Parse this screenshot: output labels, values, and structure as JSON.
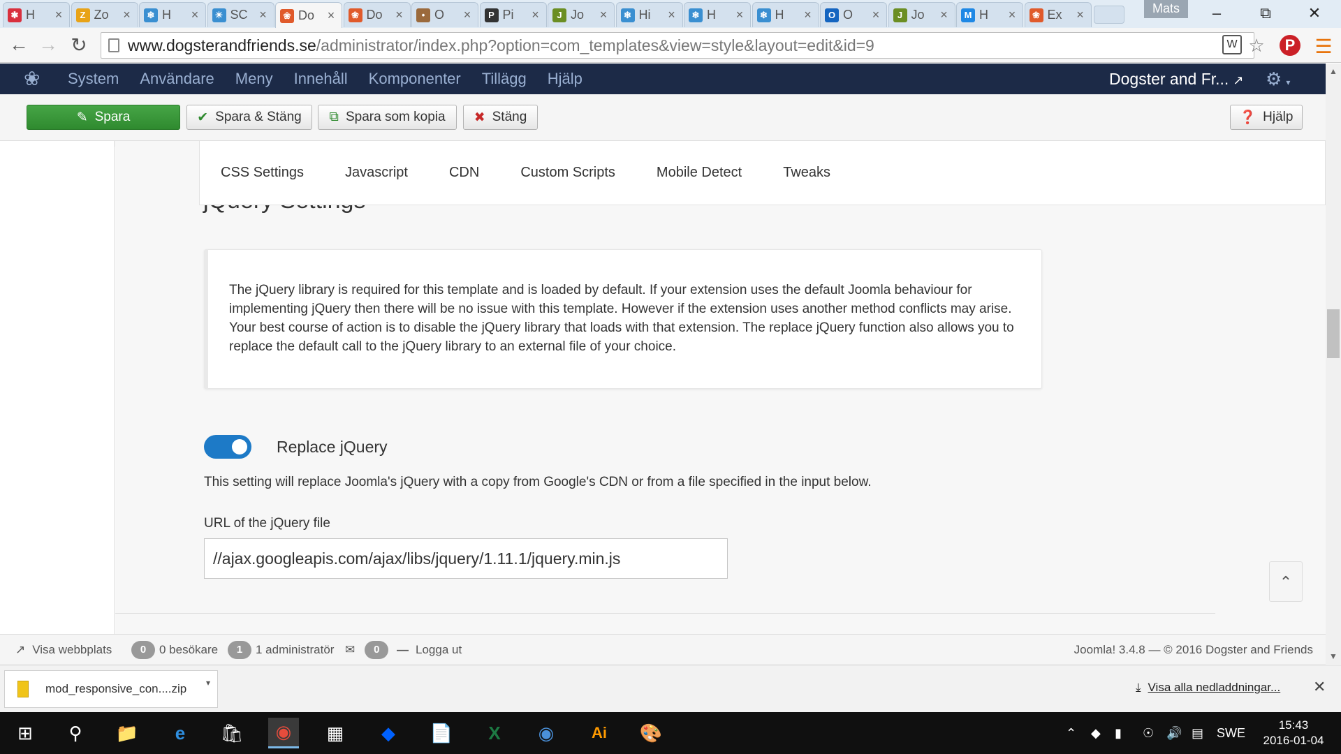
{
  "browser": {
    "tabs": [
      {
        "title": "H",
        "icon": "joomla-red-icon",
        "color": "#d9303e"
      },
      {
        "title": "Zo",
        "icon": "zoho-icon",
        "color": "#e8a317"
      },
      {
        "title": "H",
        "icon": "snowflake-icon",
        "color": "#3a8fd1"
      },
      {
        "title": "SC",
        "icon": "sun-icon",
        "color": "#3a8fd1"
      },
      {
        "title": "Do",
        "icon": "joomla-icon",
        "color": "#e05a2b",
        "active": true
      },
      {
        "title": "Do",
        "icon": "joomla-icon",
        "color": "#e05a2b"
      },
      {
        "title": "O",
        "icon": "dog-icon",
        "color": "#9b6a3c"
      },
      {
        "title": "Pi",
        "icon": "pinterest-icon",
        "color": "#333333"
      },
      {
        "title": "Jo",
        "icon": "joomla-j-icon",
        "color": "#6b8e23"
      },
      {
        "title": "Hi",
        "icon": "snowflake-icon",
        "color": "#3a8fd1"
      },
      {
        "title": "H",
        "icon": "snowflake-icon",
        "color": "#3a8fd1"
      },
      {
        "title": "H",
        "icon": "snowflake-icon",
        "color": "#3a8fd1"
      },
      {
        "title": "O",
        "icon": "outlook-icon",
        "color": "#1565c0"
      },
      {
        "title": "Jo",
        "icon": "joomla-j-icon",
        "color": "#6b8e23"
      },
      {
        "title": "H",
        "icon": "mj-icon",
        "color": "#1e88e5"
      },
      {
        "title": "Ex",
        "icon": "joomla-icon",
        "color": "#e05a2b"
      }
    ],
    "profile_name": "Mats",
    "url_host": "www.dogsterandfriends.se",
    "url_path": "/administrator/index.php?option=com_templates&view=style&layout=edit&id=9"
  },
  "joomla_nav": {
    "menu": [
      "System",
      "Användare",
      "Meny",
      "Innehåll",
      "Komponenter",
      "Tillägg",
      "Hjälp"
    ],
    "site_name": "Dogster and Fr..."
  },
  "toolbar": {
    "save": "Spara",
    "save_close": "Spara & Stäng",
    "save_copy": "Spara som kopia",
    "close": "Stäng",
    "help": "Hjälp"
  },
  "tabs": [
    "CSS Settings",
    "Javascript",
    "CDN",
    "Custom Scripts",
    "Mobile Detect",
    "Tweaks"
  ],
  "content": {
    "section_title": "jQuery Settings",
    "info_text": "The jQuery library is required for this template and is loaded by default. If your extension uses the default Joomla behaviour for implementing jQuery then there will be no issue with this template. However if the extension uses another method conflicts may arise. Your best course of action is to disable the jQuery library that loads with that extension. The replace jQuery function also allows you to replace the default call to the jQuery library to an external file of your choice.",
    "toggle_label": "Replace jQuery",
    "toggle_on": true,
    "help_text": "This setting will replace Joomla's jQuery with a copy from Google's CDN or from a file specified in the input below.",
    "field_label": "URL of the jQuery file",
    "field_value": "//ajax.googleapis.com/ajax/libs/jquery/1.11.1/jquery.min.js"
  },
  "status": {
    "visit_site": "Visa webbplats",
    "visitors_count": "0",
    "visitors_label": "0 besökare",
    "admins_count": "1",
    "admins_label": "1 administratör",
    "messages_count": "0",
    "logout": "Logga ut",
    "footer": "Joomla! 3.4.8 — © 2016 Dogster and Friends"
  },
  "downloads": {
    "file": "mod_responsive_con....zip",
    "show_all": "Visa alla nedladdningar..."
  },
  "taskbar": {
    "language": "SWE",
    "time": "15:43",
    "date": "2016-01-04"
  },
  "colors": {
    "nav_bg": "#1c2a47",
    "save_green": "#46a546",
    "toggle_blue": "#1d7ac7"
  }
}
